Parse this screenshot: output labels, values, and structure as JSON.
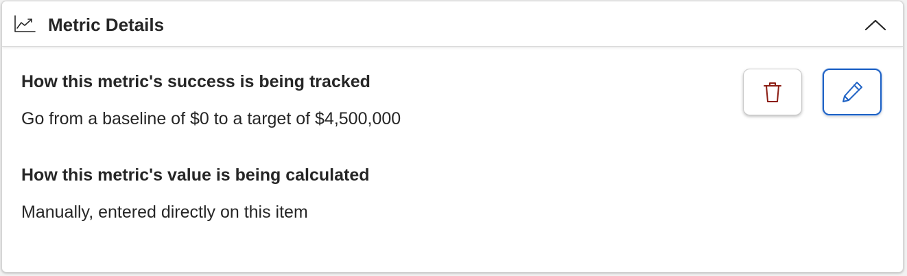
{
  "header": {
    "title": "Metric Details",
    "icon": "trending-chart-icon",
    "collapse_icon": "chevron-up-icon"
  },
  "body": {
    "sections": [
      {
        "heading": "How this metric's success is being tracked",
        "text": "Go from a baseline of $0 to a target of $4,500,000"
      },
      {
        "heading": "How this metric's value is being calculated",
        "text": "Manually, entered directly on this item"
      }
    ]
  },
  "actions": {
    "delete_icon": "trash-icon",
    "edit_icon": "pencil-icon"
  },
  "colors": {
    "delete": "#8b1c12",
    "edit": "#1f62c4",
    "text": "#262626"
  }
}
